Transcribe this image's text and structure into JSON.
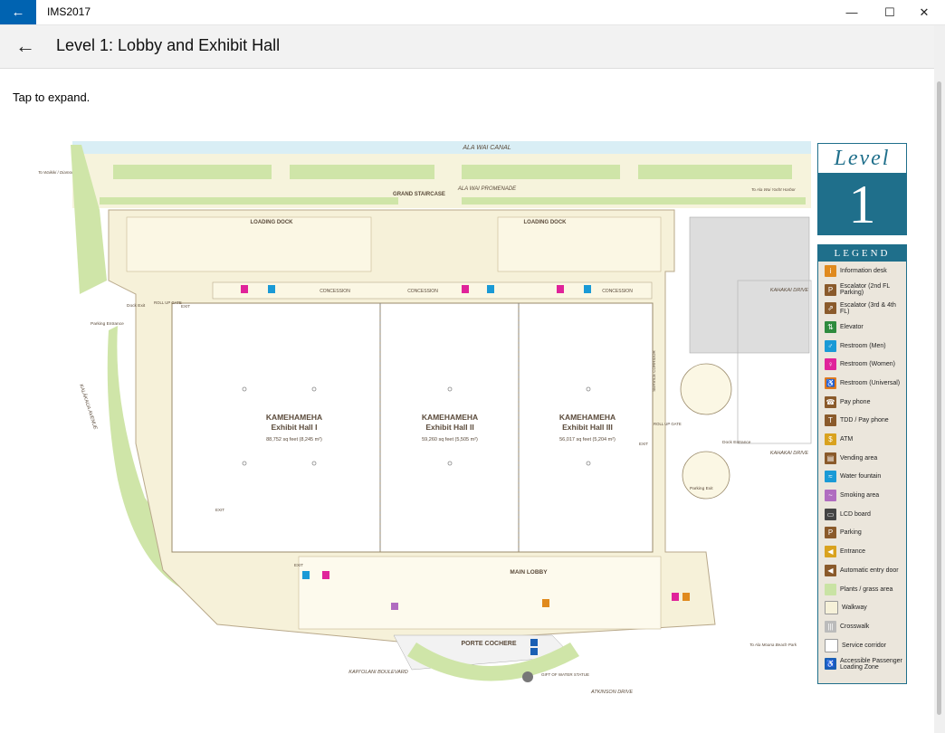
{
  "window": {
    "title": "IMS2017",
    "minimize": "—",
    "maximize": "☐",
    "close": "✕"
  },
  "header": {
    "title": "Level 1: Lobby and Exhibit Hall"
  },
  "hint": "Tap to expand.",
  "level": {
    "word": "Level",
    "number": "1"
  },
  "legend": {
    "heading": "LEGEND",
    "items": [
      {
        "label": "Information desk",
        "color": "#e08a1e",
        "glyph": "i"
      },
      {
        "label": "Escalator (2nd FL Parking)",
        "color": "#8a5a2b",
        "glyph": "P"
      },
      {
        "label": "Escalator (3rd & 4th FL)",
        "color": "#8a5a2b",
        "glyph": "⇗"
      },
      {
        "label": "Elevator",
        "color": "#2e8b3e",
        "glyph": "⇅"
      },
      {
        "label": "Restroom (Men)",
        "color": "#1a9ad6",
        "glyph": "♂"
      },
      {
        "label": "Restroom (Women)",
        "color": "#e0239a",
        "glyph": "♀"
      },
      {
        "label": "Restroom (Universal)",
        "color": "#e07a1e",
        "glyph": "♿"
      },
      {
        "label": "Pay phone",
        "color": "#8a5a2b",
        "glyph": "☎"
      },
      {
        "label": "TDD / Pay phone",
        "color": "#8a5a2b",
        "glyph": "T"
      },
      {
        "label": "ATM",
        "color": "#d9a21e",
        "glyph": "$"
      },
      {
        "label": "Vending area",
        "color": "#8a5a2b",
        "glyph": "▤"
      },
      {
        "label": "Water fountain",
        "color": "#1a9ad6",
        "glyph": "≈"
      },
      {
        "label": "Smoking area",
        "color": "#b06cc0",
        "glyph": "~"
      },
      {
        "label": "LCD board",
        "color": "#444444",
        "glyph": "▭"
      },
      {
        "label": "Parking",
        "color": "#8a5a2b",
        "glyph": "P"
      },
      {
        "label": "Entrance",
        "color": "#d9a21e",
        "glyph": "◀"
      },
      {
        "label": "Automatic entry door",
        "color": "#8a5a2b",
        "glyph": "◀"
      },
      {
        "label": "Plants / grass area",
        "color": "#c9e3a4",
        "glyph": ""
      },
      {
        "label": "Walkway",
        "color": "#f6f1d9",
        "glyph": ""
      },
      {
        "label": "Crosswalk",
        "color": "#bbbbbb",
        "glyph": "|||"
      },
      {
        "label": "Service corridor",
        "color": "#ffffff",
        "glyph": ""
      },
      {
        "label": "Accessible Passenger Loading Zone",
        "color": "#1a5fb4",
        "glyph": "♿"
      }
    ]
  },
  "map": {
    "canal": "ALA WAI CANAL",
    "promenade": "ALA WAI PROMENADE",
    "grand_staircase": "GRAND STAIRCASE",
    "loading_dock_left": "LOADING DOCK",
    "loading_dock_right": "LOADING DOCK",
    "concession_1": "CONCESSION",
    "concession_2": "CONCESSION",
    "concession_3": "CONCESSION",
    "to_waikiki": "To Waikiki / Diamond Head",
    "to_yacht": "To Ala Wai Yacht Harbor",
    "to_ala_moana": "To Ala Moana Beach Park",
    "kalakaua": "KALĀKAUA AVENUE",
    "kahakai_1": "KAHAKAI DRIVE",
    "kahakai_2": "KAHAKAI DRIVE",
    "kapiolani": "KAPIʻOLANI BOULEVARD",
    "atkinson": "ATKINSON DRIVE",
    "porte_cochere": "PORTE COCHERE",
    "main_lobby": "MAIN LOBBY",
    "service_corridor": "SERVICE CORRIDOR",
    "dock_exit": "Dock Exit",
    "dock_entrance": "Dock Entrance",
    "parking_entrance": "Parking Entrance",
    "parking_exit": "Parking Exit",
    "gift_of_water": "GIFT OF WATER STATUE",
    "roll_up_gate_1": "ROLL UP GATE",
    "roll_up_gate_2": "ROLL UP GATE",
    "exit": "EXIT",
    "halls": [
      {
        "name1": "KAMEHAMEHA",
        "name2": "Exhibit Hall I",
        "size": "88,752 sq feet (8,245 m²)"
      },
      {
        "name1": "KAMEHAMEHA",
        "name2": "Exhibit Hall II",
        "size": "59,260 sq feet (5,505 m²)"
      },
      {
        "name1": "KAMEHAMEHA",
        "name2": "Exhibit Hall III",
        "size": "56,017 sq feet (5,204 m²)"
      }
    ]
  }
}
